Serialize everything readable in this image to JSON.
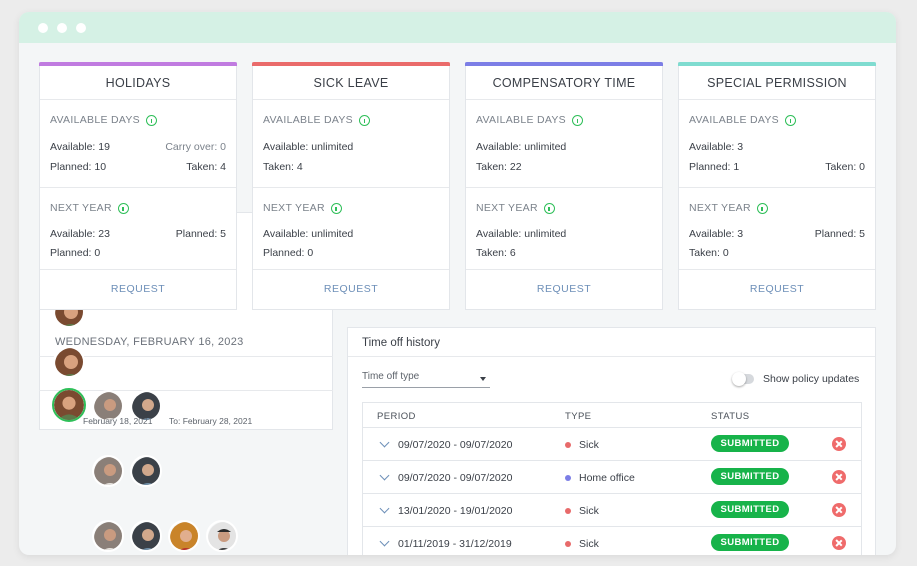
{
  "cards": [
    {
      "title": "HOLIDAYS",
      "accent": "#c07be0",
      "available_days_label": "AVAILABLE DAYS",
      "current": [
        {
          "left": "Available: 19",
          "right": "Carry over: 0"
        },
        {
          "left": "Planned: 10",
          "right": "Taken: 4"
        }
      ],
      "next_year_label": "NEXT YEAR",
      "next": [
        {
          "left": "Available: 23",
          "right": "Planned: 5"
        },
        {
          "left": "Planned: 0",
          "right": ""
        }
      ],
      "request_label": "REQUEST"
    },
    {
      "title": "SICK LEAVE",
      "accent": "#ea6b6b",
      "available_days_label": "AVAILABLE DAYS",
      "current": [
        {
          "left": "Available: unlimited",
          "right": ""
        },
        {
          "left": "Taken: 4",
          "right": ""
        }
      ],
      "next_year_label": "NEXT YEAR",
      "next": [
        {
          "left": "Available: unlimited",
          "right": ""
        },
        {
          "left": "Planned: 0",
          "right": ""
        }
      ],
      "request_label": "REQUEST"
    },
    {
      "title": "COMPENSATORY TIME",
      "accent": "#7c7ee6",
      "available_days_label": "AVAILABLE DAYS",
      "current": [
        {
          "left": "Available: unlimited",
          "right": ""
        },
        {
          "left": "Taken: 22",
          "right": ""
        }
      ],
      "next_year_label": "NEXT YEAR",
      "next": [
        {
          "left": "Available: unlimited",
          "right": ""
        },
        {
          "left": "Taken: 6",
          "right": ""
        }
      ],
      "request_label": "REQUEST"
    },
    {
      "title": "SPECIAL PERMISSION",
      "accent": "#7fdcd0",
      "available_days_label": "AVAILABLE DAYS",
      "current": [
        {
          "left": "Available: 3",
          "right": ""
        },
        {
          "left": "Planned: 1",
          "right": "Taken: 0"
        }
      ],
      "next_year_label": "NEXT YEAR",
      "next": [
        {
          "left": "Available: 3",
          "right": "Planned: 5"
        },
        {
          "left": "Taken: 0",
          "right": ""
        }
      ],
      "request_label": "REQUEST"
    }
  ],
  "calendar": {
    "date_label": "WEDNESDAY, FEBRUARY 16, 2023",
    "from_value": "February 18, 2021",
    "to_label": "To:",
    "to_value": "February 28, 2021"
  },
  "history": {
    "title": "Time off history",
    "type_select": "Time off type",
    "toggle_label": "Show policy updates",
    "columns": [
      "PERIOD",
      "TYPE",
      "STATUS"
    ],
    "rows": [
      {
        "period": "09/07/2020 - 09/07/2020",
        "type": "Sick",
        "type_color": "#e86a6a",
        "status": "SUBMITTED"
      },
      {
        "period": "09/07/2020 - 09/07/2020",
        "type": "Home office",
        "type_color": "#7c7ee6",
        "status": "SUBMITTED"
      },
      {
        "period": "13/01/2020 - 19/01/2020",
        "type": "Sick",
        "type_color": "#e86a6a",
        "status": "SUBMITTED"
      },
      {
        "period": "01/11/2019 - 31/12/2019",
        "type": "Sick",
        "type_color": "#e86a6a",
        "status": "SUBMITTED"
      }
    ]
  },
  "colors": {
    "status_green": "#17b34a",
    "remove_red": "#ef6b6b",
    "link_blue": "#6d8fb8",
    "titlebar": "#d5f1e5"
  }
}
